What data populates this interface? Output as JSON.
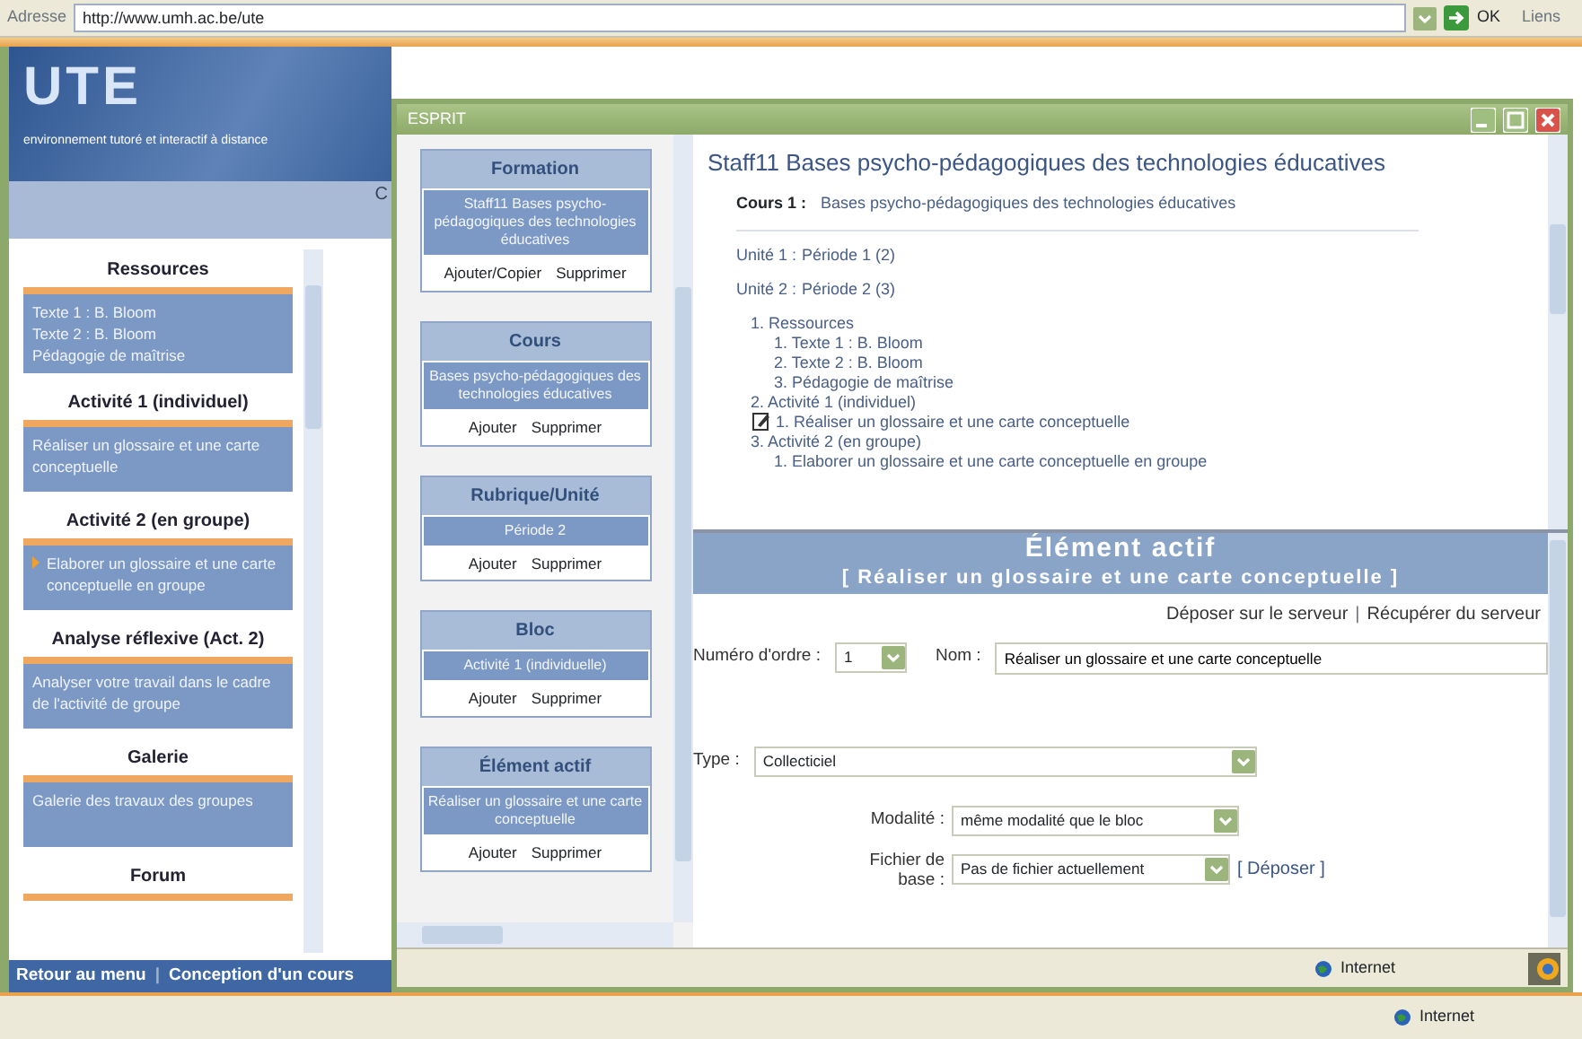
{
  "address_bar": {
    "label": "Adresse",
    "url": "http://www.umh.ac.be/ute",
    "go": "OK",
    "links": "Liens"
  },
  "site": {
    "logo": "UTE",
    "tagline": "environnement tutoré et interactif à distance",
    "nav_partial": "C",
    "sections": [
      {
        "title": "Ressources",
        "items": [
          {
            "text": "Texte 1 : B. Bloom",
            "current": false
          },
          {
            "text": "Texte 2 : B. Bloom",
            "current": false
          },
          {
            "text": "Pédagogie de maîtrise",
            "current": false
          }
        ]
      },
      {
        "title": "Activité 1 (individuel)",
        "items": [
          {
            "text": "Réaliser un glossaire et une carte conceptuelle",
            "current": false
          }
        ]
      },
      {
        "title": "Activité 2 (en groupe)",
        "items": [
          {
            "text": "Elaborer un glossaire et une carte conceptuelle en groupe",
            "current": true
          }
        ]
      },
      {
        "title": "Analyse réflexive (Act. 2)",
        "items": [
          {
            "text": "Analyser votre travail dans le cadre de l'activité de groupe",
            "current": false
          }
        ]
      },
      {
        "title": "Galerie",
        "items": [
          {
            "text": "Galerie des travaux des groupes",
            "current": false
          }
        ]
      },
      {
        "title": "Forum"
      }
    ],
    "footer_links": [
      "Retour au menu",
      "Conception d'un cours"
    ],
    "footer_separator": "|"
  },
  "esprit": {
    "title": "ESPRIT",
    "panels": [
      {
        "title": "Formation",
        "value": "Staff11 Bases psycho-pédagogiques des technologies éducatives",
        "actions": [
          "Ajouter/Copier",
          "Supprimer"
        ]
      },
      {
        "title": "Cours",
        "value": "Bases psycho-pédagogiques des technologies éducatives",
        "actions": [
          "Ajouter",
          "Supprimer"
        ]
      },
      {
        "title": "Rubrique/Unité",
        "value": "Période 2",
        "actions": [
          "Ajouter",
          "Supprimer"
        ]
      },
      {
        "title": "Bloc",
        "value": "Activité 1 (individuelle)",
        "actions": [
          "Ajouter",
          "Supprimer"
        ]
      },
      {
        "title": "Élément actif",
        "value": "Réaliser un glossaire et une carte conceptuelle",
        "actions": [
          "Ajouter",
          "Supprimer"
        ]
      }
    ],
    "outline": {
      "title": "Staff11 Bases psycho-pédagogiques des technologies éducatives",
      "course_label": "Cours 1 :",
      "course": "Bases psycho-pédagogiques des technologies éducatives",
      "units": [
        {
          "label": "Unité 1 :",
          "name": "Période 1",
          "count": "(2)"
        },
        {
          "label": "Unité 2 :",
          "name": "Période 2",
          "count": "(3)",
          "children": [
            {
              "num": "1.",
              "text": "Ressources",
              "active": false,
              "children": [
                {
                  "num": "1.",
                  "text": "Texte 1 : B. Bloom",
                  "active": false
                },
                {
                  "num": "2.",
                  "text": "Texte 2 : B. Bloom",
                  "active": false
                },
                {
                  "num": "3.",
                  "text": "Pédagogie de maîtrise",
                  "active": false
                }
              ]
            },
            {
              "num": "2.",
              "text": "Activité 1 (individuel)",
              "active": false,
              "children": [
                {
                  "num": "1.",
                  "text": "Réaliser un glossaire et une carte conceptuelle",
                  "active": true
                }
              ]
            },
            {
              "num": "3.",
              "text": "Activité 2 (en groupe)",
              "active": false,
              "children": [
                {
                  "num": "1.",
                  "text": "Elaborer un glossaire et une carte conceptuelle en groupe",
                  "active": false
                }
              ]
            }
          ]
        }
      ]
    },
    "form": {
      "title": "Élément actif",
      "subtitle": "[ Réaliser un glossaire et une carte conceptuelle ]",
      "links": [
        "Déposer sur le serveur",
        "Récupérer du serveur"
      ],
      "separator": "|",
      "order_label": "Numéro d'ordre :",
      "order": "1",
      "name_label": "Nom :",
      "name": "Réaliser un glossaire et une carte conceptuelle",
      "type_label": "Type :",
      "type": "Collecticiel",
      "mode_label": "Modalité :",
      "mode": "même modalité que le bloc",
      "file_label": "Fichier de base :",
      "file": "Pas de fichier actuellement",
      "upload": "[ Déposer ]"
    },
    "status": "Internet"
  },
  "status_bar": {
    "zone": "Internet"
  }
}
